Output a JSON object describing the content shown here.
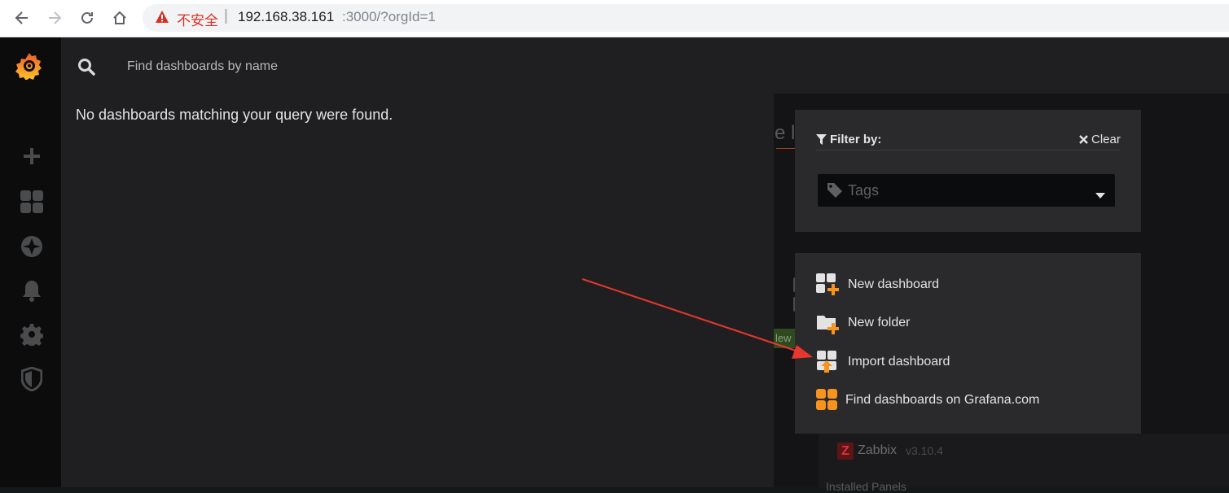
{
  "browser": {
    "security_label": "不安全",
    "separator": "|",
    "url_host": "192.168.38.161",
    "url_rest": ":3000/?orgId=1"
  },
  "sidemenu": {
    "items": [
      "grafana-logo-icon",
      "plus-icon",
      "dashboards-icon",
      "explore-icon",
      "alerting-bell-icon",
      "configuration-gear-icon",
      "server-admin-shield-icon"
    ]
  },
  "search": {
    "placeholder": "Find dashboards by name",
    "no_results": "No dashboards matching your query were found."
  },
  "filter": {
    "label": "Filter by:",
    "clear_label": "Clear",
    "tags_placeholder": "Tags"
  },
  "actions": [
    {
      "label": "New dashboard",
      "icon": "new-dashboard-icon"
    },
    {
      "label": "New folder",
      "icon": "new-folder-icon"
    },
    {
      "label": "Import dashboard",
      "icon": "import-dashboard-icon"
    },
    {
      "label": "Find dashboards on Grafana.com",
      "icon": "grafana-com-dashboards-icon"
    }
  ],
  "background": {
    "ghost_heading": "e l",
    "ghost_new": "lew",
    "plugin_badge": "Z",
    "plugin_name": "Zabbix",
    "plugin_version": "v3.10.4",
    "section_partial": "Installed Panels"
  },
  "colors": {
    "accent_orange": "#f7941e",
    "annotation_arrow": "#e8372e",
    "panel_bg": "#2a2a2c",
    "page_bg": "#1f1f21"
  }
}
